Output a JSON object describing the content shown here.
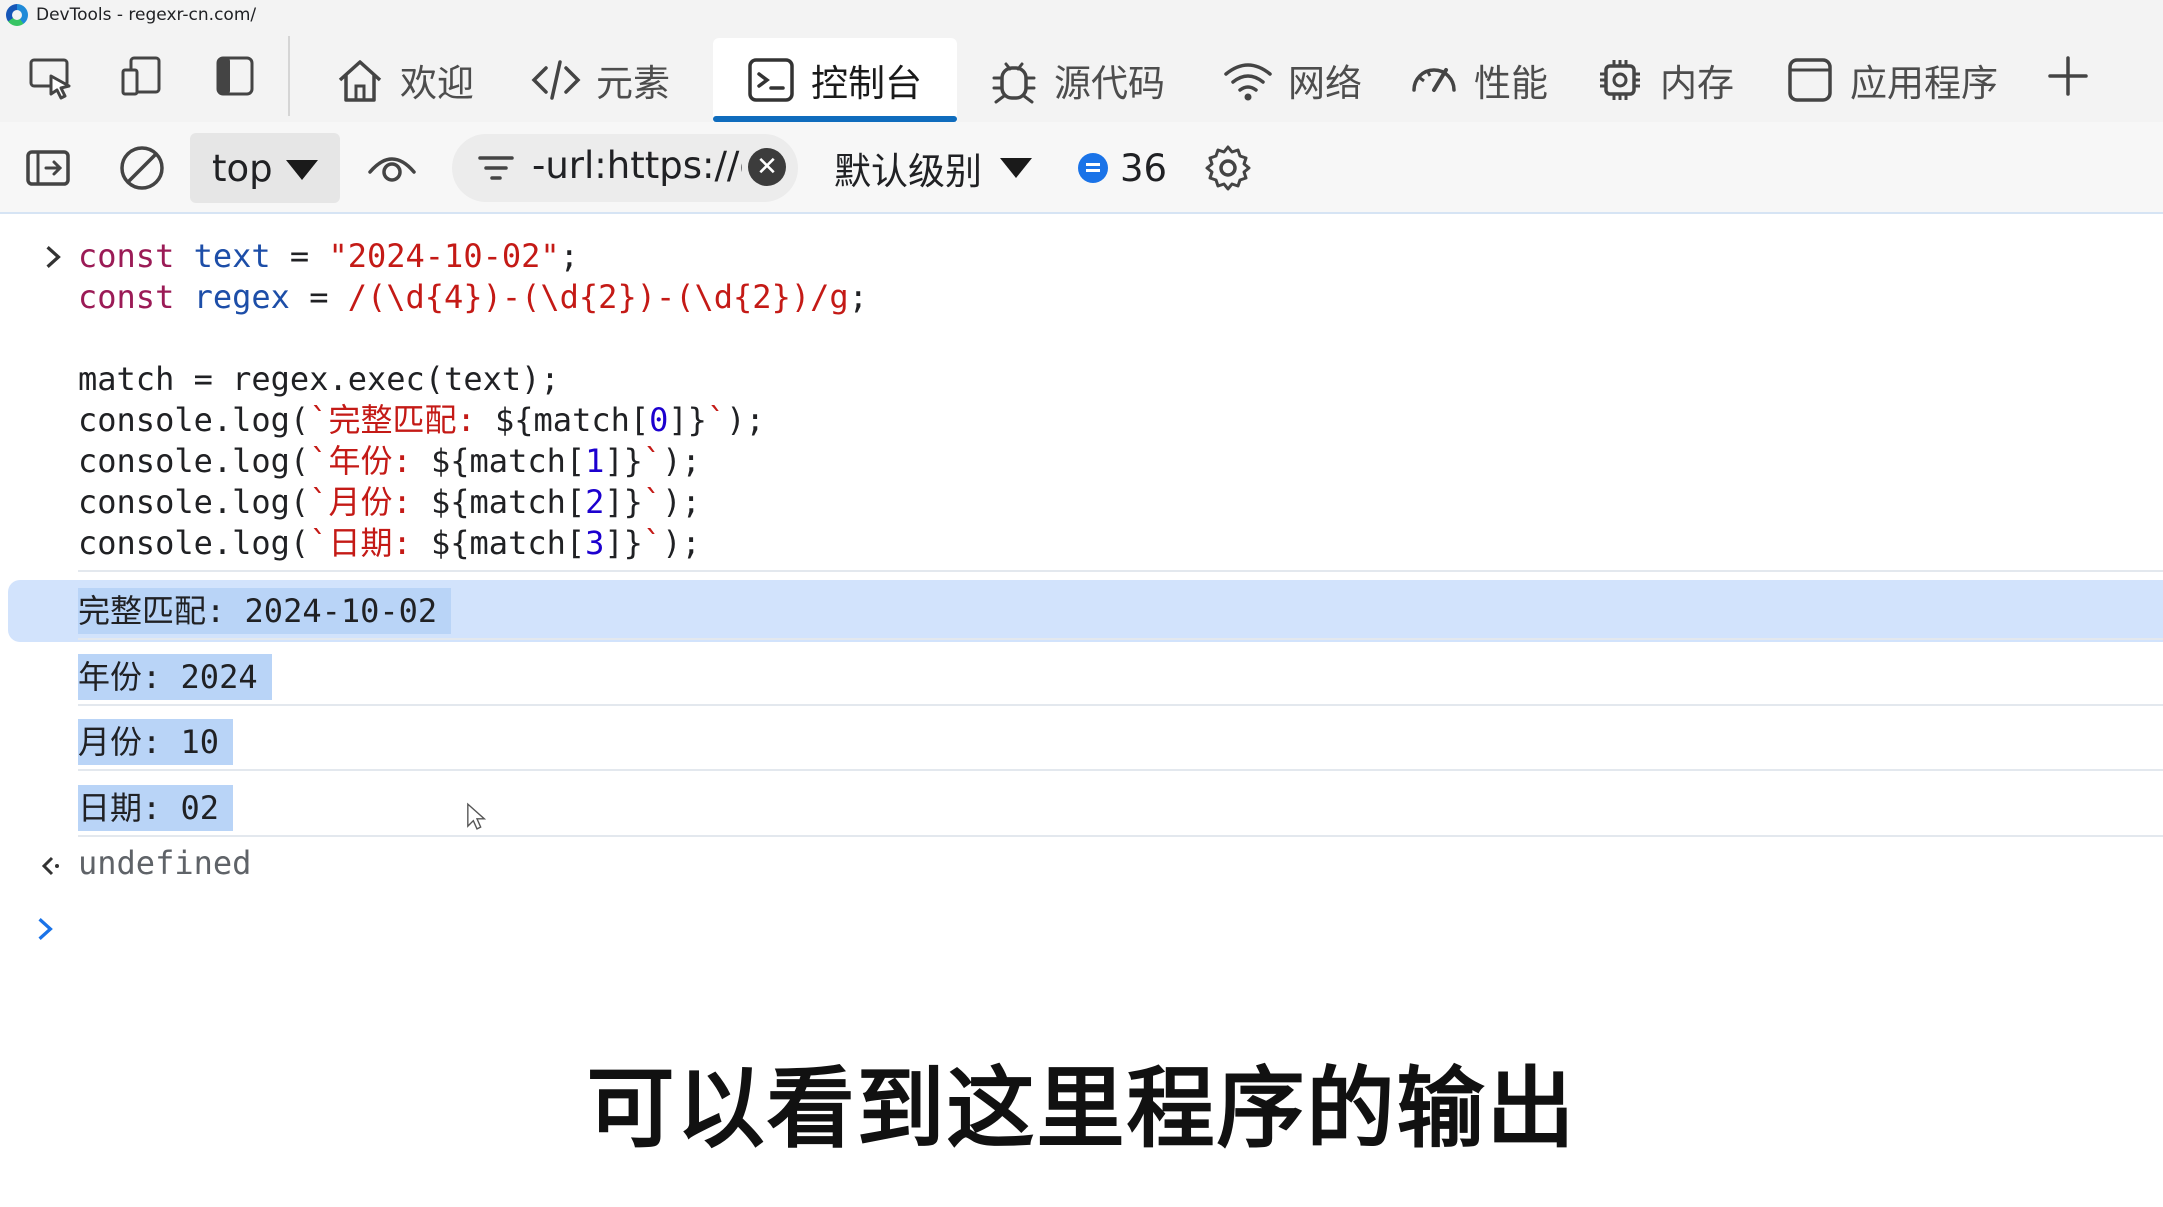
{
  "window": {
    "title": "DevTools - regexr-cn.com/"
  },
  "tabs": [
    {
      "label": "欢迎",
      "icon": "home-icon"
    },
    {
      "label": "元素",
      "icon": "code-tag-icon"
    },
    {
      "label": "控制台",
      "icon": "console-icon",
      "active": true
    },
    {
      "label": "源代码",
      "icon": "bug-icon"
    },
    {
      "label": "网络",
      "icon": "wifi-icon"
    },
    {
      "label": "性能",
      "icon": "gauge-icon"
    },
    {
      "label": "内存",
      "icon": "chip-icon"
    },
    {
      "label": "应用程序",
      "icon": "app-window-icon"
    }
  ],
  "toolbar": {
    "context": "top",
    "filter_value": "-url:https://de",
    "level": "默认级别",
    "message_count": "36"
  },
  "console": {
    "code_lines": [
      [
        [
          "kw",
          "const "
        ],
        [
          "var",
          "text"
        ],
        [
          "pl",
          " = "
        ],
        [
          "str",
          "\"2024-10-02\""
        ],
        [
          "pl",
          ";"
        ]
      ],
      [
        [
          "kw",
          "const "
        ],
        [
          "var",
          "regex"
        ],
        [
          "pl",
          " = "
        ],
        [
          "str",
          "/(\\d{4})-(\\d{2})-(\\d{2})/g"
        ],
        [
          "pl",
          ";"
        ]
      ],
      [
        [
          "pl",
          ""
        ]
      ],
      [
        [
          "pl",
          "match = regex.exec(text);"
        ]
      ],
      [
        [
          "pl",
          "console.log("
        ],
        [
          "str",
          "`完整匹配: "
        ],
        [
          "pl",
          "${match["
        ],
        [
          "num",
          "0"
        ],
        [
          "pl",
          "]}"
        ],
        [
          "str",
          "`"
        ],
        [
          "pl",
          ");"
        ]
      ],
      [
        [
          "pl",
          "console.log("
        ],
        [
          "str",
          "`年份: "
        ],
        [
          "pl",
          "${match["
        ],
        [
          "num",
          "1"
        ],
        [
          "pl",
          "]}"
        ],
        [
          "str",
          "`"
        ],
        [
          "pl",
          ");"
        ]
      ],
      [
        [
          "pl",
          "console.log("
        ],
        [
          "str",
          "`月份: "
        ],
        [
          "pl",
          "${match["
        ],
        [
          "num",
          "2"
        ],
        [
          "pl",
          "]}"
        ],
        [
          "str",
          "`"
        ],
        [
          "pl",
          ");"
        ]
      ],
      [
        [
          "pl",
          "console.log("
        ],
        [
          "str",
          "`日期: "
        ],
        [
          "pl",
          "${match["
        ],
        [
          "num",
          "3"
        ],
        [
          "pl",
          "]}"
        ],
        [
          "str",
          "`"
        ],
        [
          "pl",
          ");"
        ]
      ]
    ],
    "outputs": [
      {
        "text": "完整匹配: 2024-10-02",
        "selected_row": true
      },
      {
        "text": "年份: 2024"
      },
      {
        "text": "月份: 10"
      },
      {
        "text": "日期: 02"
      }
    ],
    "return_value": "undefined"
  },
  "subtitle": "可以看到这里程序的输出"
}
